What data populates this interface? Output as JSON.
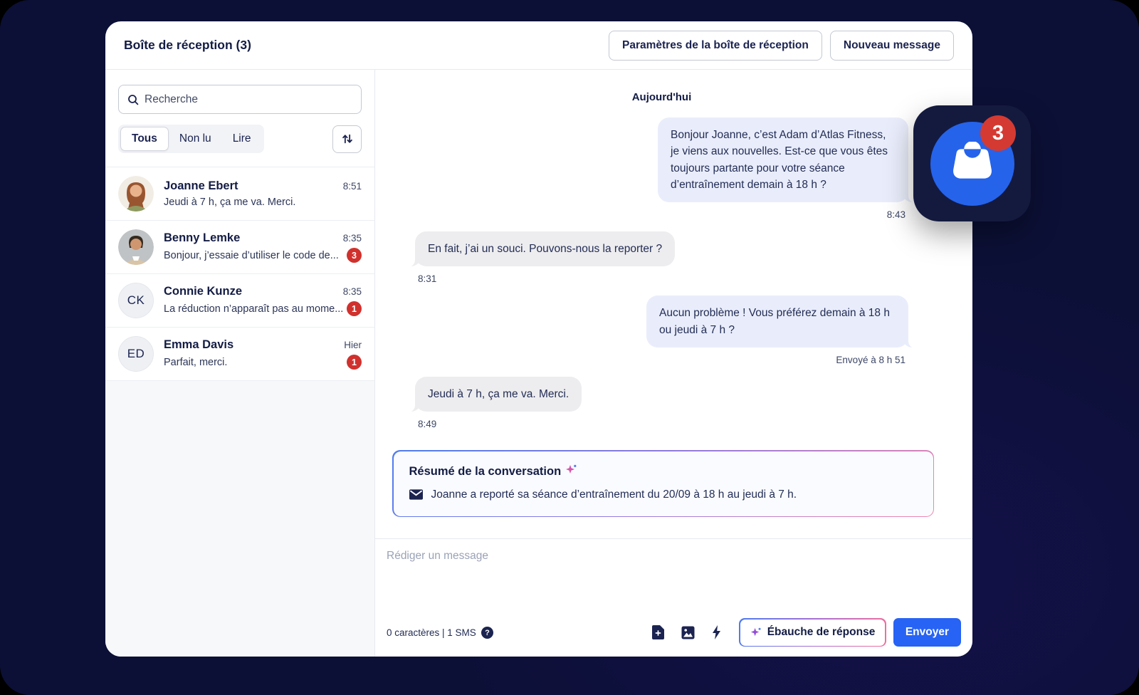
{
  "header": {
    "title": "Boîte de réception (3)",
    "settings_button": "Paramètres de la boîte de réception",
    "new_message_button": "Nouveau message"
  },
  "sidebar": {
    "search_placeholder": "Recherche",
    "filters": {
      "all": "Tous",
      "unread": "Non lu",
      "read": "Lire"
    },
    "conversations": [
      {
        "name": "Joanne Ebert",
        "time": "8:51",
        "preview": "Jeudi à 7 h, ça me va. Merci.",
        "badge": "",
        "avatar": "photo-woman"
      },
      {
        "name": "Benny Lemke",
        "time": "8:35",
        "preview": "Bonjour, j’essaie d’utiliser le code de...",
        "badge": "3",
        "avatar": "photo-man"
      },
      {
        "name": "Connie Kunze",
        "time": "8:35",
        "preview": "La réduction n’apparaît pas au mome...",
        "badge": "1",
        "avatar": "CK"
      },
      {
        "name": "Emma Davis",
        "time": "Hier",
        "preview": "Parfait, merci.",
        "badge": "1",
        "avatar": "ED"
      }
    ]
  },
  "chat": {
    "day_label": "Aujourd'hui",
    "messages": [
      {
        "direction": "outgoing",
        "text": "Bonjour Joanne, c’est Adam d’Atlas Fitness, je viens aux nouvelles. Est-ce que vous êtes toujours partante pour votre séance d’entraînement demain à 18 h ?",
        "time": "8:43"
      },
      {
        "direction": "incoming",
        "text": "En fait, j’ai un souci. Pouvons-nous la reporter ?",
        "time": "8:31"
      },
      {
        "direction": "outgoing",
        "text": "Aucun problème ! Vous préférez demain à 18 h ou jeudi à 7 h ?",
        "time": "Envoyé à 8 h 51"
      },
      {
        "direction": "incoming",
        "text": "Jeudi à 7 h, ça me va. Merci.",
        "time": "8:49"
      }
    ],
    "summary": {
      "title": "Résumé de la conversation",
      "text": "Joanne a reporté sa séance d’entraînement du 20/09 à 18 h au jeudi à 7 h."
    }
  },
  "composer": {
    "placeholder": "Rédiger un message",
    "counter": "0 caractères | 1 SMS",
    "draft_button": "Ébauche de réponse",
    "send_button": "Envoyer"
  },
  "floating_widget": {
    "badge_count": "3"
  },
  "colors": {
    "accent_blue": "#2763f4",
    "widget_blue": "#2563eb",
    "badge_red": "#d0312d",
    "outgoing_bubble": "#e9edfb",
    "incoming_bubble": "#ededef",
    "background_navy": "#0c1036"
  }
}
